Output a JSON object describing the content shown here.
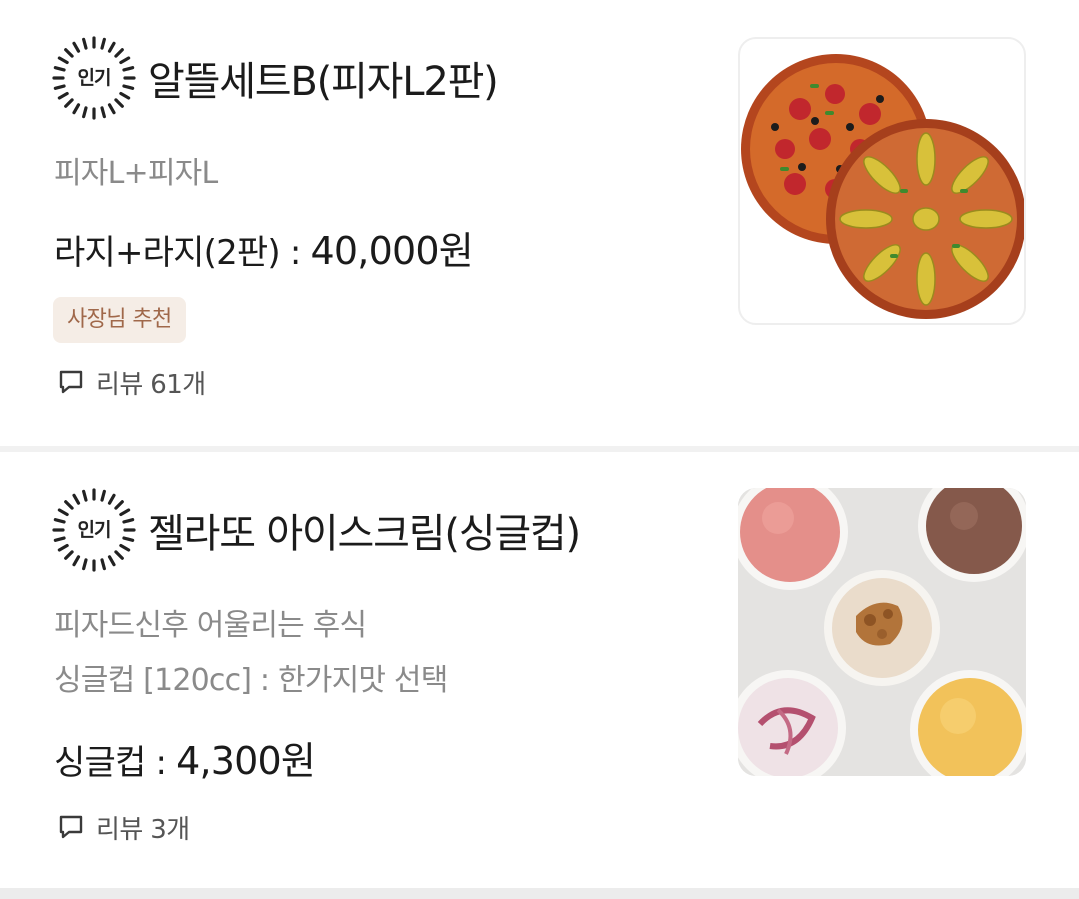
{
  "menu_items": [
    {
      "badge": "인기",
      "title": "알뜰세트B(피자L2판)",
      "descriptions": [
        "피자L+피자L"
      ],
      "price_label": "라지+라지(2판) : ",
      "price_value": "40,000원",
      "tag": "사장님 추천",
      "review_label": "리뷰 61개",
      "image": "pizza-photo"
    },
    {
      "badge": "인기",
      "title": "젤라또 아이스크림(싱글컵)",
      "descriptions": [
        "피자드신후 어울리는 후식",
        "싱글컵 [120cc] : 한가지맛 선택"
      ],
      "price_label": "싱글컵 : ",
      "price_value": "4,300원",
      "review_label": "리뷰 3개",
      "image": "gelato-photo"
    }
  ],
  "colors": {
    "tag_background": "#f5ede6",
    "tag_text": "#a0684a",
    "description_text": "#8a8a8a"
  },
  "icons": {
    "popular_badge": "sunburst-badge-icon",
    "review": "speech-bubble-icon"
  }
}
